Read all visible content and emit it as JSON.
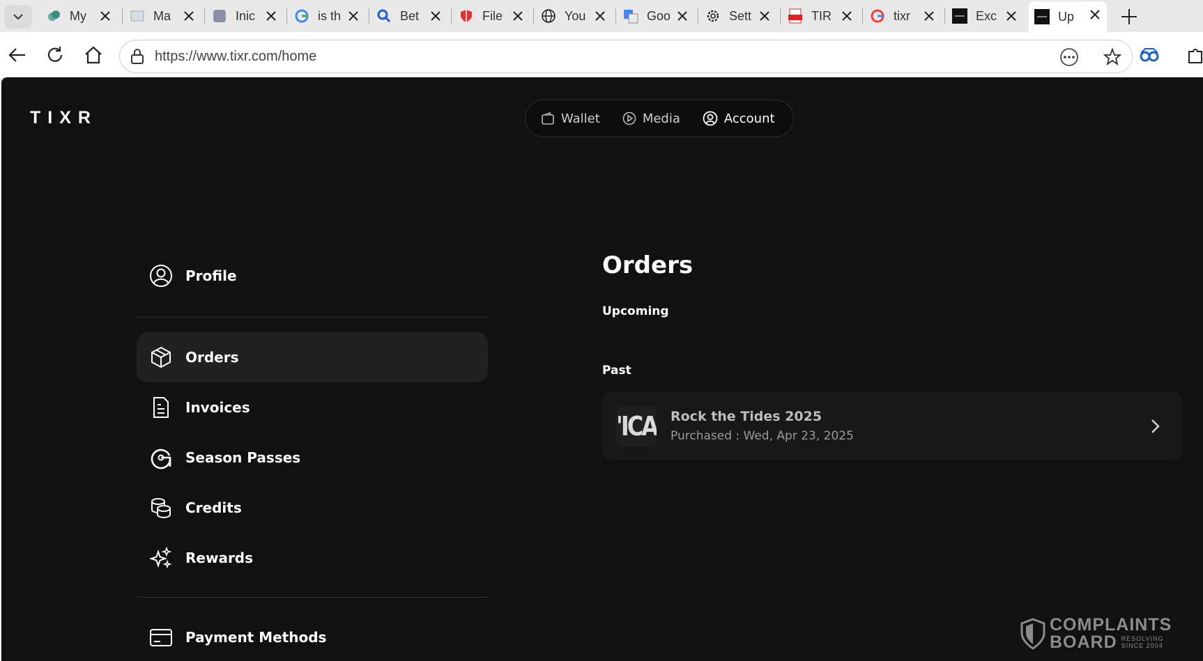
{
  "browser": {
    "tabs": [
      {
        "label": "My",
        "icon": "cloud-icon"
      },
      {
        "label": "Ma",
        "icon": "page-icon"
      },
      {
        "label": "Inic",
        "icon": "itau-icon"
      },
      {
        "label": "is th",
        "icon": "google-icon"
      },
      {
        "label": "Bet",
        "icon": "search-icon"
      },
      {
        "label": "File",
        "icon": "shield-icon"
      },
      {
        "label": "You",
        "icon": "globe-icon"
      },
      {
        "label": "Goo",
        "icon": "translate-icon"
      },
      {
        "label": "Sett",
        "icon": "gear-icon"
      },
      {
        "label": "TIR",
        "icon": "pdf-icon"
      },
      {
        "label": "tixr",
        "icon": "google-icon"
      },
      {
        "label": "Exc",
        "icon": "tixr-icon"
      },
      {
        "label": "Up",
        "icon": "tixr-icon"
      }
    ],
    "url": "https://www.tixr.com/home"
  },
  "header": {
    "logo": "TIXR",
    "nav": {
      "wallet": "Wallet",
      "media": "Media",
      "account": "Account"
    }
  },
  "sidebar": {
    "items": [
      {
        "label": "Profile",
        "icon": "user-circle-icon"
      },
      {
        "label": "Orders",
        "icon": "box-icon"
      },
      {
        "label": "Invoices",
        "icon": "invoice-icon"
      },
      {
        "label": "Season Passes",
        "icon": "season-pass-icon"
      },
      {
        "label": "Credits",
        "icon": "coins-icon"
      },
      {
        "label": "Rewards",
        "icon": "sparkles-icon"
      },
      {
        "label": "Payment Methods",
        "icon": "credit-card-icon"
      }
    ]
  },
  "main": {
    "title": "Orders",
    "upcoming_label": "Upcoming",
    "past_label": "Past",
    "past_orders": [
      {
        "thumb_text": "'ICA",
        "name": "Rock the Tides 2025",
        "purchased": "Purchased : Wed, Apr 23, 2025"
      }
    ]
  },
  "watermark": {
    "line1": "COMPLAINTS",
    "line2": "BOARD",
    "tag1": "RESOLVING",
    "tag2": "SINCE 2004"
  },
  "colors": {
    "page_bg": "#111111",
    "active_item_bg": "#212121",
    "card_bg": "#181818"
  }
}
